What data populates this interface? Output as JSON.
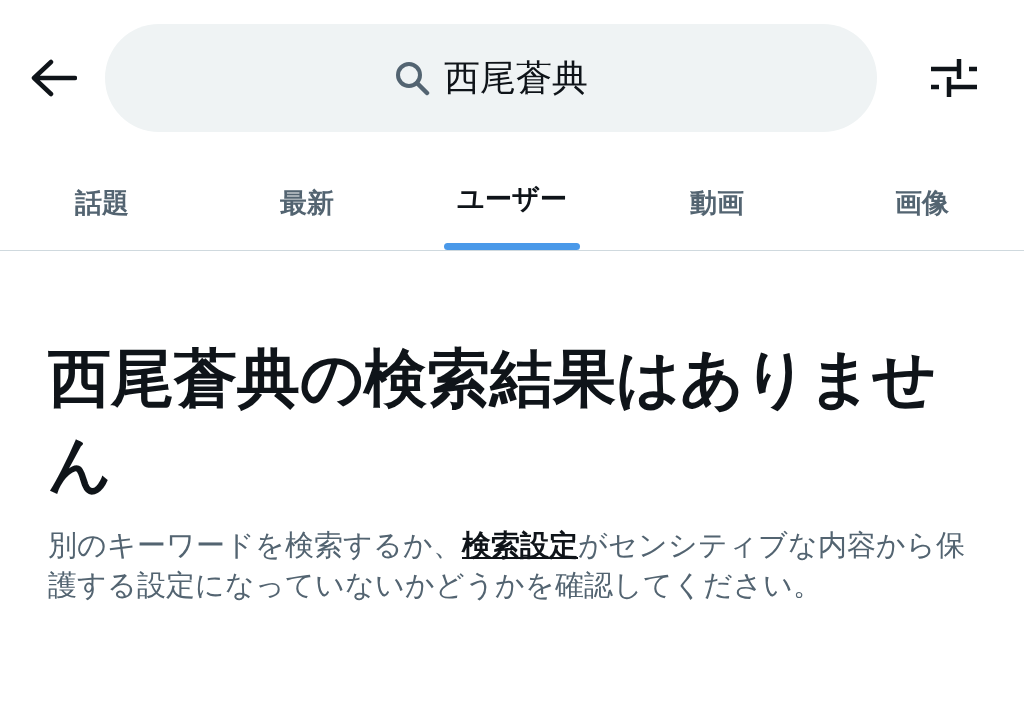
{
  "search": {
    "value": "西尾蒼典"
  },
  "tabs": [
    {
      "label": "話題",
      "selected": false
    },
    {
      "label": "最新",
      "selected": false
    },
    {
      "label": "ユーザー",
      "selected": true
    },
    {
      "label": "動画",
      "selected": false
    },
    {
      "label": "画像",
      "selected": false
    }
  ],
  "empty_state": {
    "title": "西尾蒼典の検索結果はありません",
    "message_before": "別のキーワードを検索するか、",
    "link": "検索設定",
    "message_after": "がセンシティブな内容から保護する設定になっていないかどうかを確認してください。"
  }
}
